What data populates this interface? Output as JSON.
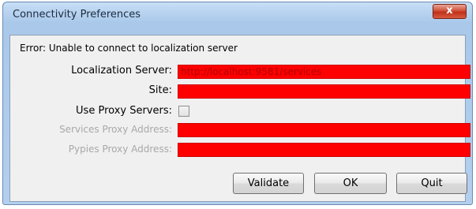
{
  "window": {
    "title": "Connectivity Preferences",
    "close_glyph": "x"
  },
  "error_message": "Error: Unable to connect to localization server",
  "form": {
    "localization_server": {
      "label": "Localization Server:",
      "value": "http://localhost:9581/services"
    },
    "site": {
      "label": "Site:",
      "value": ""
    },
    "use_proxy": {
      "label": "Use Proxy Servers:",
      "checked": false
    },
    "services_proxy": {
      "label": "Services Proxy Address:",
      "value": "",
      "enabled": false
    },
    "pypies_proxy": {
      "label": "Pypies Proxy Address:",
      "value": "",
      "enabled": false
    }
  },
  "buttons": {
    "validate": "Validate",
    "ok": "OK",
    "quit": "Quit"
  },
  "colors": {
    "field_highlight": "#ff0000",
    "disabled_label": "#a8a8a8"
  }
}
